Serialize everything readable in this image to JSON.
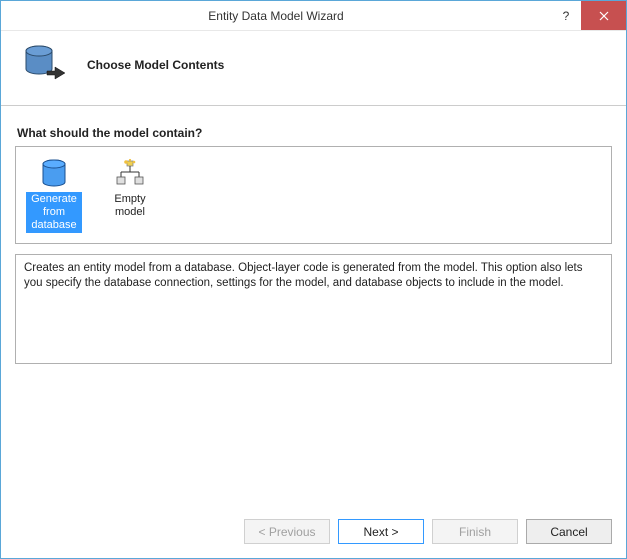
{
  "window": {
    "title": "Entity Data Model Wizard"
  },
  "header": {
    "heading": "Choose Model Contents"
  },
  "section": {
    "question": "What should the model contain?"
  },
  "options": {
    "generate": "Generate from database",
    "empty": "Empty model"
  },
  "description": {
    "text": "Creates an entity model from a database. Object-layer code is generated from the model. This option also lets you specify the database connection, settings for the model, and database objects to include in the model."
  },
  "buttons": {
    "previous": "< Previous",
    "next": "Next >",
    "finish": "Finish",
    "cancel": "Cancel"
  }
}
